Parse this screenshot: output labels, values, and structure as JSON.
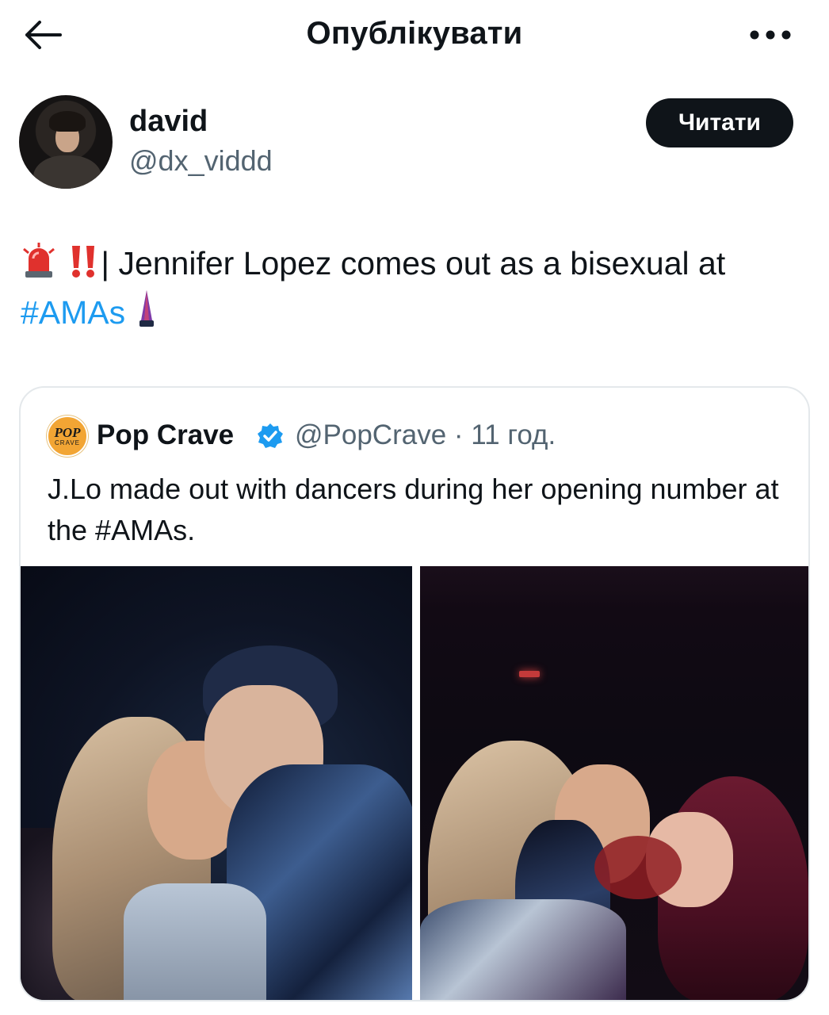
{
  "header": {
    "title": "Опублікувати",
    "back_icon": "arrow-left-icon",
    "more_icon": "more-horizontal-icon"
  },
  "author": {
    "display_name": "david",
    "handle": "@dx_viddd",
    "follow_label": "Читати"
  },
  "tweet": {
    "emoji_lead": [
      "rotating-light-emoji",
      "double-exclamation-emoji"
    ],
    "text": "| Jennifer Lopez comes out as a bisexual at ",
    "hashtag": "#AMAs",
    "emoji_trail": "purple-candle-emoji"
  },
  "quoted": {
    "name": "Pop Crave",
    "verified": true,
    "handle_time": "@PopCrave · 11 год.",
    "text": "J.Lo made out with dancers during her opening number at the #AMAs.",
    "avatar_logo_text": [
      "POP",
      "CRAVE"
    ],
    "media_count": 2
  },
  "colors": {
    "link": "#1d9bf0",
    "secondary_text": "#536471",
    "button_bg": "#0f1419",
    "card_border": "#e4e8eb"
  }
}
